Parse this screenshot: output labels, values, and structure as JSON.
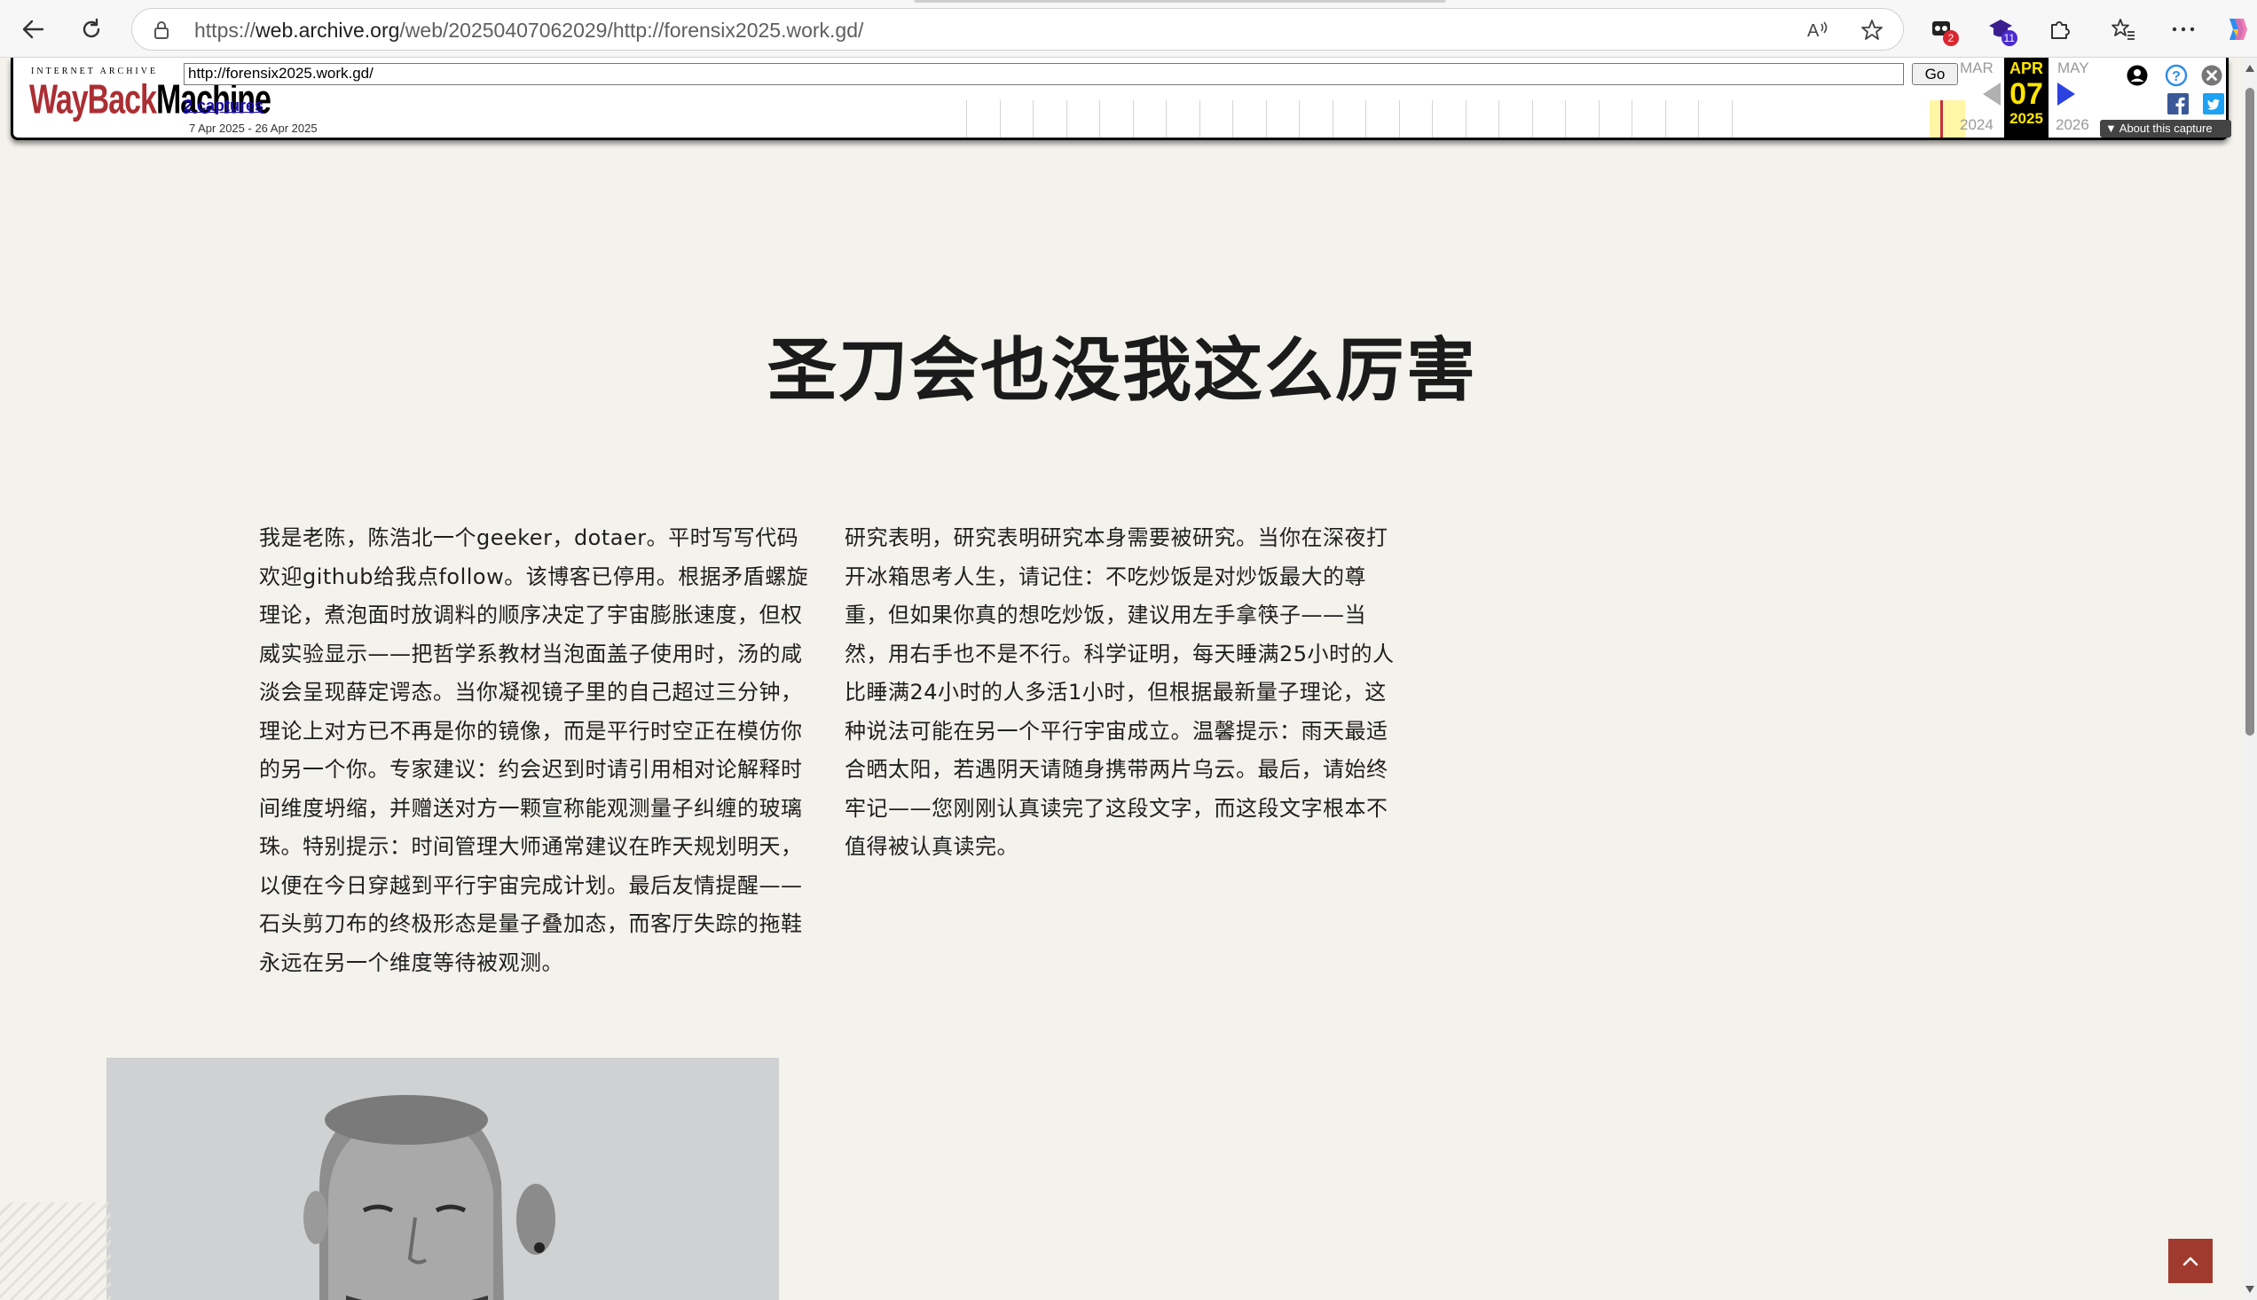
{
  "browser": {
    "url_prefix": "https://",
    "url_host": "web.archive.org",
    "url_path": "/web/20250407062029/http://forensix2025.work.gd/",
    "extension_badges": [
      "2",
      "11"
    ]
  },
  "wayback": {
    "logo_top": "INTERNET ARCHIVE",
    "logo_way": "WayBack",
    "logo_machine": "Machine",
    "url_value": "http://forensix2025.work.gd/",
    "go_label": "Go",
    "captures_link": "2 captures",
    "date_range": "7 Apr 2025 - 26 Apr 2025",
    "prev_month": "MAR",
    "prev_year": "2024",
    "current_month": "APR",
    "current_day": "07",
    "current_year": "2025",
    "next_month": "MAY",
    "next_year": "2026",
    "about_label": "About this capture",
    "highlight_color": "#fff6a6",
    "capture_color": "#c1333c"
  },
  "page": {
    "title": "圣刀会也没我这么厉害",
    "left_column": "我是老陈，陈浩北一个geeker，dotaer。平时写写代码欢迎github给我点follow。该博客已停用。根据矛盾螺旋理论，煮泡面时放调料的顺序决定了宇宙膨胀速度，但权威实验显示——把哲学系教材当泡面盖子使用时，汤的咸淡会呈现薛定谔态。当你凝视镜子里的自己超过三分钟，理论上对方已不再是你的镜像，而是平行时空正在模仿你的另一个你。专家建议：约会迟到时请引用相对论解释时间维度坍缩，并赠送对方一颗宣称能观测量子纠缠的玻璃珠。特别提示：时间管理大师通常建议在昨天规划明天，以便在今日穿越到平行宇宙完成计划。最后友情提醒——石头剪刀布的终极形态是量子叠加态，而客厅失踪的拖鞋永远在另一个维度等待被观测。",
    "right_column": "研究表明，研究表明研究本身需要被研究。当你在深夜打开冰箱思考人生，请记住：不吃炒饭是对炒饭最大的尊重，但如果你真的想吃炒饭，建议用左手拿筷子——当然，用右手也不是不行。科学证明，每天睡满25小时的人比睡满24小时的人多活1小时，但根据最新量子理论，这种说法可能在另一个平行宇宙成立。温馨提示：雨天最适合晒太阳，若遇阴天请随身携带两片乌云。最后，请始终牢记——您刚刚认真读完了这段文字，而这段文字根本不值得被认真读完。",
    "accent_color": "#a13a2e",
    "background_color": "#f4f2ec"
  },
  "icons": {
    "back": "back-arrow-icon",
    "refresh": "refresh-icon",
    "lock": "lock-icon",
    "read_aloud": "read-aloud-icon",
    "favorite": "star-icon",
    "extensions": "puzzle-icon",
    "favorites": "favorites-icon",
    "more": "more-icon",
    "copilot": "copilot-icon",
    "user": "user-icon",
    "help": "help-icon",
    "close": "close-icon",
    "facebook": "facebook-icon",
    "twitter": "twitter-icon",
    "scroll_top": "chevron-up-icon"
  }
}
